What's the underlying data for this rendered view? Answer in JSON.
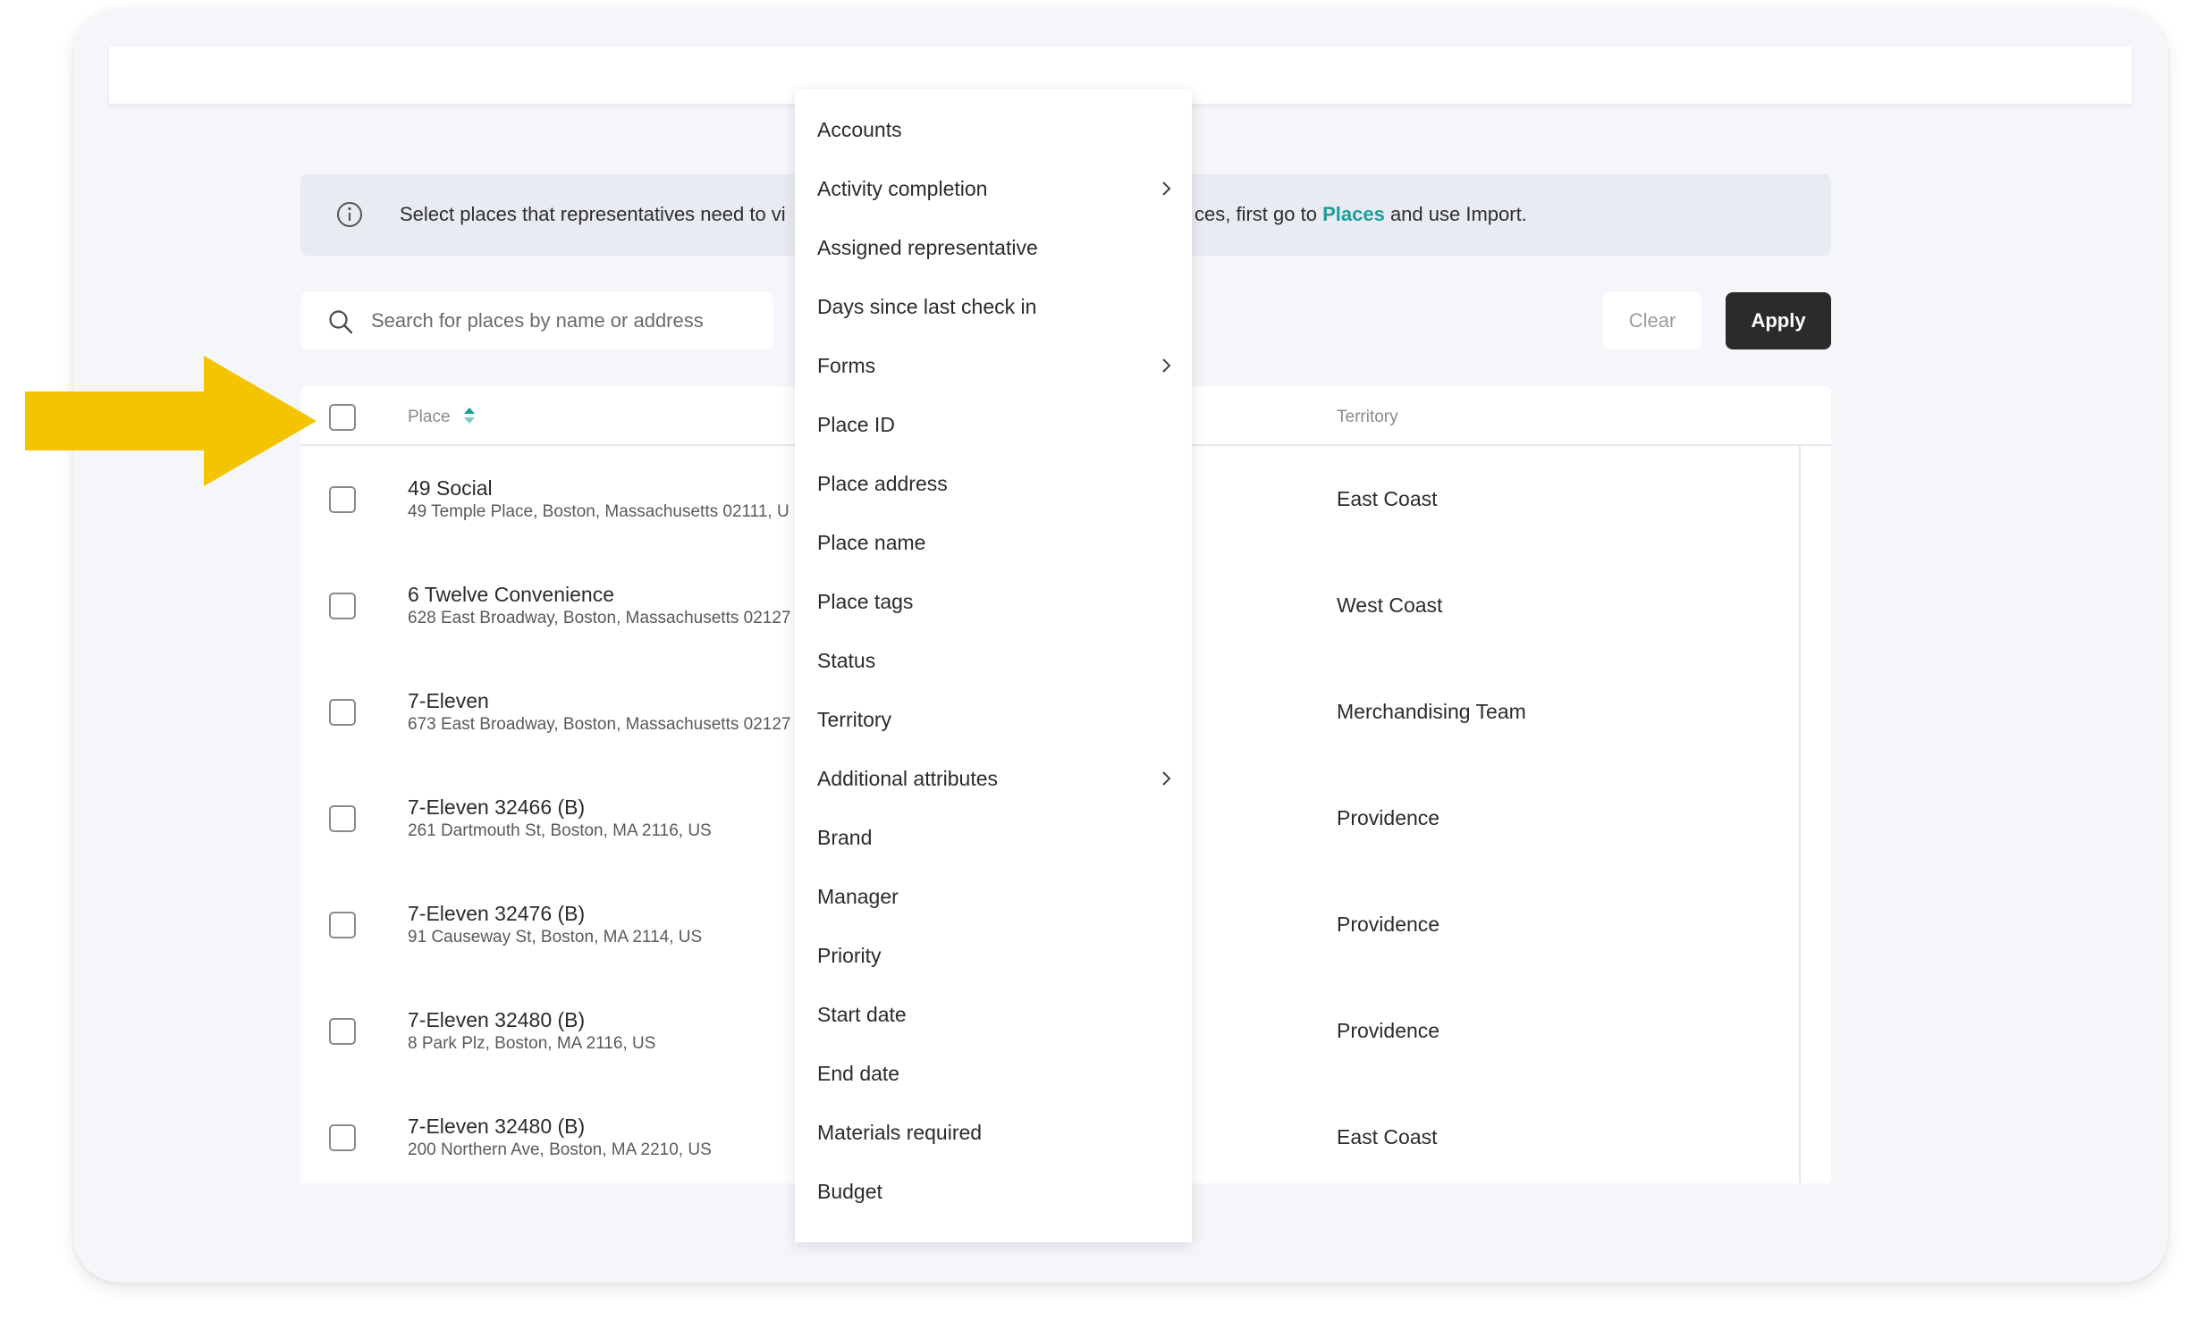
{
  "banner": {
    "text_start": "Select places that representatives need to vi",
    "text_end_pre": "ces, first go to",
    "link": "Places",
    "text_end_post": "and use Import."
  },
  "search": {
    "placeholder": "Search for places by name or address"
  },
  "buttons": {
    "clear": "Clear",
    "apply": "Apply"
  },
  "table": {
    "columns": {
      "place": "Place",
      "territory": "Territory"
    },
    "rows": [
      {
        "name": "49 Social",
        "address": "49 Temple Place, Boston, Massachusetts 02111, U",
        "territory": "East Coast"
      },
      {
        "name": "6 Twelve Convenience",
        "address": "628 East Broadway, Boston, Massachusetts 02127",
        "territory": "West Coast"
      },
      {
        "name": "7-Eleven",
        "address": "673 East Broadway, Boston, Massachusetts 02127",
        "territory": "Merchandising Team"
      },
      {
        "name": "7-Eleven 32466 (B)",
        "address": "261 Dartmouth St, Boston, MA 2116, US",
        "territory": "Providence"
      },
      {
        "name": "7-Eleven 32476 (B)",
        "address": "91 Causeway St, Boston, MA 2114, US",
        "territory": "Providence"
      },
      {
        "name": "7-Eleven 32480 (B)",
        "address": "8 Park Plz, Boston, MA 2116, US",
        "territory": "Providence"
      },
      {
        "name": "7-Eleven 32480 (B)",
        "address": "200 Northern Ave, Boston, MA 2210, US",
        "territory": "East Coast"
      }
    ]
  },
  "menu": {
    "items": [
      {
        "label": "Accounts",
        "submenu": false
      },
      {
        "label": "Activity completion",
        "submenu": true
      },
      {
        "label": "Assigned representative",
        "submenu": false
      },
      {
        "label": "Days since last check in",
        "submenu": false
      },
      {
        "label": "Forms",
        "submenu": true
      },
      {
        "label": "Place ID",
        "submenu": false
      },
      {
        "label": "Place address",
        "submenu": false
      },
      {
        "label": "Place name",
        "submenu": false
      },
      {
        "label": "Place tags",
        "submenu": false
      },
      {
        "label": "Status",
        "submenu": false
      },
      {
        "label": "Territory",
        "submenu": false
      },
      {
        "label": "Additional attributes",
        "submenu": true
      },
      {
        "label": "Brand",
        "submenu": false
      },
      {
        "label": "Manager",
        "submenu": false
      },
      {
        "label": "Priority",
        "submenu": false
      },
      {
        "label": "Start date",
        "submenu": false
      },
      {
        "label": "End date",
        "submenu": false
      },
      {
        "label": "Materials required",
        "submenu": false
      },
      {
        "label": "Budget",
        "submenu": false
      }
    ]
  },
  "colors": {
    "accent": "#1a9e98",
    "apply_button": "#2b2b2b",
    "arrow": "#f5c400",
    "background": "#f5f6fa"
  },
  "icons": {
    "info": "info-icon",
    "search": "search-icon",
    "sort": "sort-icon",
    "chevron": "chevron-right-icon",
    "arrow": "pointer-arrow-icon"
  }
}
